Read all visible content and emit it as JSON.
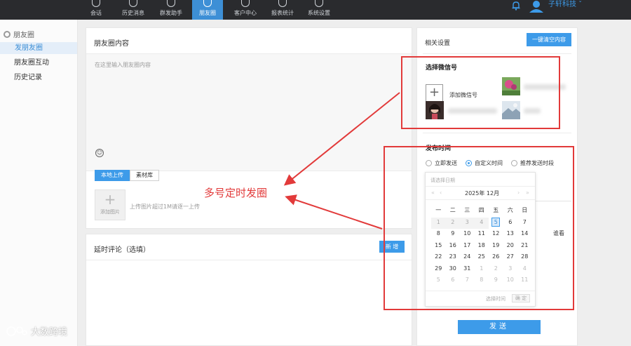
{
  "nav": {
    "items": [
      {
        "label": "会话"
      },
      {
        "label": "历史消息"
      },
      {
        "label": "群发助手"
      },
      {
        "label": "朋友圈"
      },
      {
        "label": "客户中心"
      },
      {
        "label": "报表统计"
      },
      {
        "label": "系统设置"
      }
    ],
    "active_index": 3,
    "user_name": "子轩科技 ˇ"
  },
  "sidebar": {
    "group": "朋友圈",
    "items": [
      {
        "label": "发朋友圈"
      },
      {
        "label": "朋友圈互动"
      },
      {
        "label": "历史记录"
      }
    ]
  },
  "post": {
    "title": "朋友圈内容",
    "placeholder": "在这里输入朋友圈内容",
    "tabs": [
      {
        "label": "本地上传"
      },
      {
        "label": "素材库"
      }
    ],
    "add_image_label": "添加图片",
    "upload_hint": "上传图片超过1M请逐一上传"
  },
  "comment": {
    "title": "延时评论（选填）",
    "new_label": "新 增"
  },
  "settings": {
    "title": "相关设置",
    "clear_label": "一键清空内容",
    "wechat_title": "选择微信号",
    "add_wechat_label": "添加微信号",
    "publish_title": "发布时间",
    "options": [
      {
        "label": "立即发送"
      },
      {
        "label": "自定义时间"
      },
      {
        "label": "推荐发送时段"
      }
    ],
    "selected_option": 1,
    "peek_text": "谁看",
    "send_label": "发送"
  },
  "datepicker": {
    "placeholder": "请选择日期",
    "month_label": "2025年 12月",
    "nav_prev_year": "«",
    "nav_prev": "‹",
    "nav_next": "›",
    "nav_next_year": "»",
    "weekdays": [
      "一",
      "二",
      "三",
      "四",
      "五",
      "六",
      "日"
    ],
    "days": [
      [
        {
          "d": "1",
          "s": "past"
        },
        {
          "d": "2",
          "s": "past"
        },
        {
          "d": "3",
          "s": "past"
        },
        {
          "d": "4",
          "s": "past"
        },
        {
          "d": "5",
          "s": "today"
        },
        {
          "d": "6",
          "s": ""
        },
        {
          "d": "7",
          "s": ""
        }
      ],
      [
        {
          "d": "8",
          "s": ""
        },
        {
          "d": "9",
          "s": ""
        },
        {
          "d": "10",
          "s": ""
        },
        {
          "d": "11",
          "s": ""
        },
        {
          "d": "12",
          "s": ""
        },
        {
          "d": "13",
          "s": ""
        },
        {
          "d": "14",
          "s": ""
        }
      ],
      [
        {
          "d": "15",
          "s": ""
        },
        {
          "d": "16",
          "s": ""
        },
        {
          "d": "17",
          "s": ""
        },
        {
          "d": "18",
          "s": ""
        },
        {
          "d": "19",
          "s": ""
        },
        {
          "d": "20",
          "s": ""
        },
        {
          "d": "21",
          "s": ""
        }
      ],
      [
        {
          "d": "22",
          "s": ""
        },
        {
          "d": "23",
          "s": ""
        },
        {
          "d": "24",
          "s": ""
        },
        {
          "d": "25",
          "s": ""
        },
        {
          "d": "26",
          "s": ""
        },
        {
          "d": "27",
          "s": ""
        },
        {
          "d": "28",
          "s": ""
        }
      ],
      [
        {
          "d": "29",
          "s": ""
        },
        {
          "d": "30",
          "s": ""
        },
        {
          "d": "31",
          "s": ""
        },
        {
          "d": "1",
          "s": "dim"
        },
        {
          "d": "2",
          "s": "dim"
        },
        {
          "d": "3",
          "s": "dim"
        },
        {
          "d": "4",
          "s": "dim"
        }
      ],
      [
        {
          "d": "5",
          "s": "dim"
        },
        {
          "d": "6",
          "s": "dim"
        },
        {
          "d": "7",
          "s": "dim"
        },
        {
          "d": "8",
          "s": "dim"
        },
        {
          "d": "9",
          "s": "dim"
        },
        {
          "d": "10",
          "s": "dim"
        },
        {
          "d": "11",
          "s": "dim"
        }
      ]
    ],
    "select_time_label": "选择时间",
    "ok_label": "确 定"
  },
  "annotation": {
    "text": "多号定时发圈",
    "color": "#e23a3a"
  },
  "watermark": {
    "text": "大数跨境"
  },
  "colors": {
    "accent": "#3d9be9",
    "topbar": "#2a2b2e"
  }
}
